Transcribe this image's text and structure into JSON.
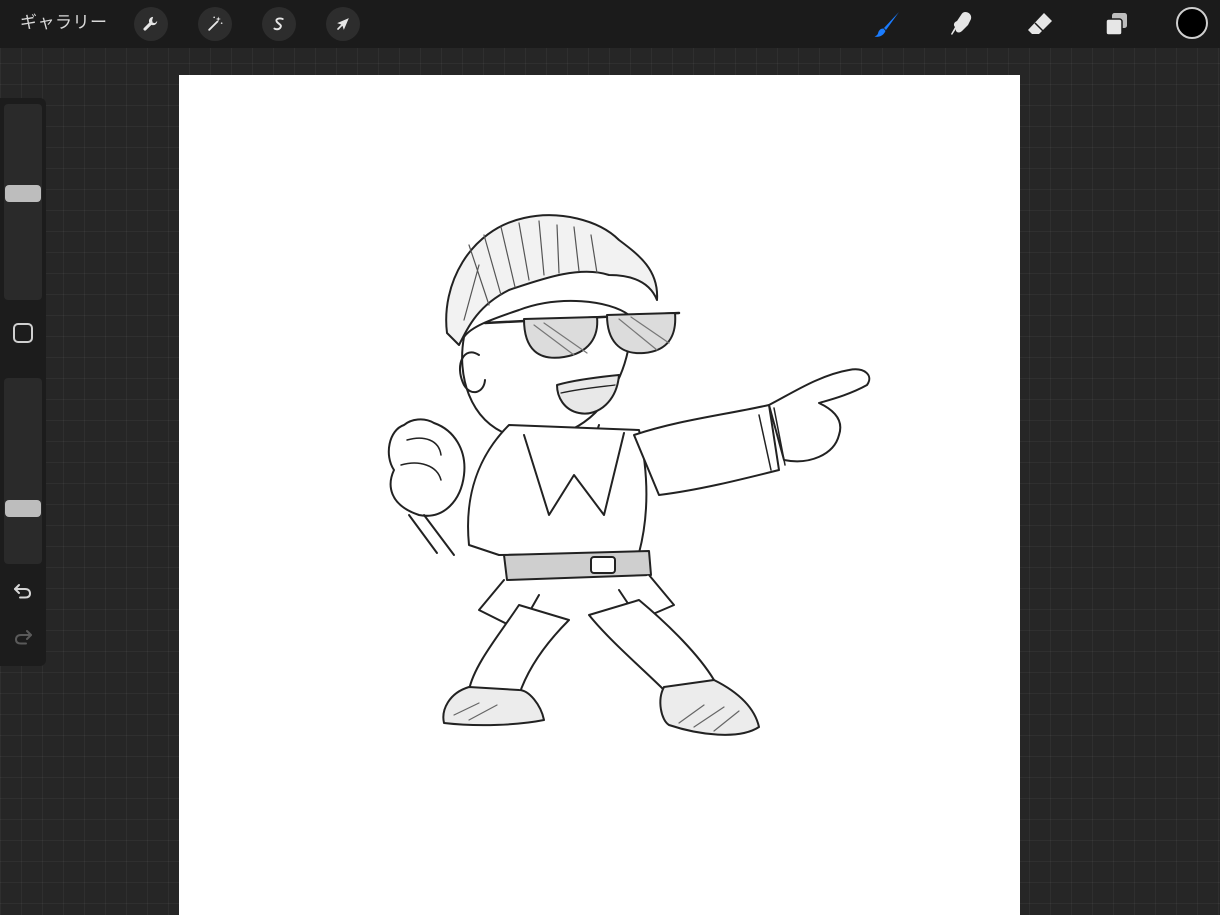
{
  "toolbar": {
    "gallery_label": "ギャラリー",
    "actions_icon": "wrench-icon",
    "adjustments_icon": "magic-wand-icon",
    "selection_icon": "selection-s-icon",
    "transform_icon": "arrow-cursor-icon",
    "brush_icon": "brush-icon",
    "smudge_icon": "smudge-finger-icon",
    "eraser_icon": "eraser-icon",
    "layers_icon": "layers-icon",
    "active_tool": "brush",
    "current_color": "#000000",
    "accent_color": "#1a7cff"
  },
  "sidebar": {
    "brush_size_level": 0.45,
    "opacity_level": 0.72,
    "modify_icon": "square-modify-icon",
    "undo_icon": "undo-icon",
    "redo_icon": "redo-icon"
  },
  "canvas": {
    "background_color": "#ffffff",
    "artwork": "pencil-sketch-character-illustration"
  }
}
